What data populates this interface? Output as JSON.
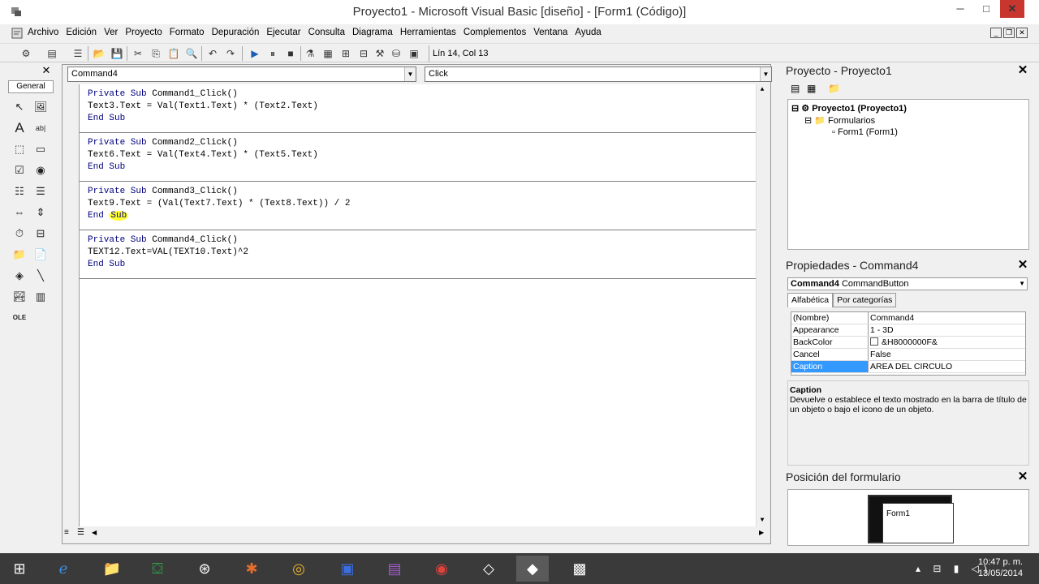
{
  "window": {
    "title": "Proyecto1 - Microsoft Visual Basic [diseño] - [Form1 (Código)]",
    "minimize": "─",
    "maximize": "□",
    "close": "✕"
  },
  "menu": {
    "items": [
      "Archivo",
      "Edición",
      "Ver",
      "Proyecto",
      "Formato",
      "Depuración",
      "Ejecutar",
      "Consulta",
      "Diagrama",
      "Herramientas",
      "Complementos",
      "Ventana",
      "Ayuda"
    ]
  },
  "toolbar": {
    "position": "Lín 14, Col 13"
  },
  "toolbox": {
    "tab": "General",
    "close": "✕"
  },
  "code": {
    "object_combo": "Command4",
    "proc_combo": "Click",
    "procs": [
      {
        "l1a": "Private Sub",
        "l1b": " Command1_Click()",
        "l2": "Text3.Text = Val(Text1.Text) * (Text2.Text)",
        "l3": "End Sub"
      },
      {
        "l1a": "Private Sub",
        "l1b": " Command2_Click()",
        "l2": "Text6.Text = Val(Text4.Text) * (Text5.Text)",
        "l3": "End Sub"
      },
      {
        "l1a": "Private Sub",
        "l1b": " Command3_Click()",
        "l2": "Text9.Text = (Val(Text7.Text) * (Text8.Text)) / 2",
        "l3a": "End ",
        "l3b": "Sub"
      },
      {
        "l1a": "Private Sub",
        "l1b": " Command4_Click()",
        "l2": "TEXT12.Text=VAL(TEXT10.Text)^2",
        "l3": "End Sub"
      }
    ]
  },
  "project": {
    "title": "Proyecto - Proyecto1",
    "root": "Proyecto1 (Proyecto1)",
    "folder": "Formularios",
    "form": "Form1 (Form1)"
  },
  "properties": {
    "title": "Propiedades - Command4",
    "object_name": "Command4",
    "object_type": "CommandButton",
    "tabs": [
      "Alfabética",
      "Por categorías"
    ],
    "rows": [
      {
        "k": "(Nombre)",
        "v": "Command4"
      },
      {
        "k": "Appearance",
        "v": "1 - 3D"
      },
      {
        "k": "BackColor",
        "v": "&H8000000F&"
      },
      {
        "k": "Cancel",
        "v": "False"
      },
      {
        "k": "Caption",
        "v": "AREA DEL CIRCULO"
      }
    ],
    "desc_title": "Caption",
    "desc_text": "Devuelve o establece el texto mostrado en la barra de título de un objeto o bajo el icono de un objeto."
  },
  "form_position": {
    "title": "Posición del formulario",
    "form_label": "Form1"
  },
  "taskbar": {
    "time": "10:47 p. m.",
    "date": "13/05/2014"
  },
  "colors": {
    "keyword": "#00007f",
    "selection": "#3399ff",
    "cursor_highlight": "#ffff33",
    "close_button": "#c7372f",
    "taskbar": "#3a3a3a"
  }
}
